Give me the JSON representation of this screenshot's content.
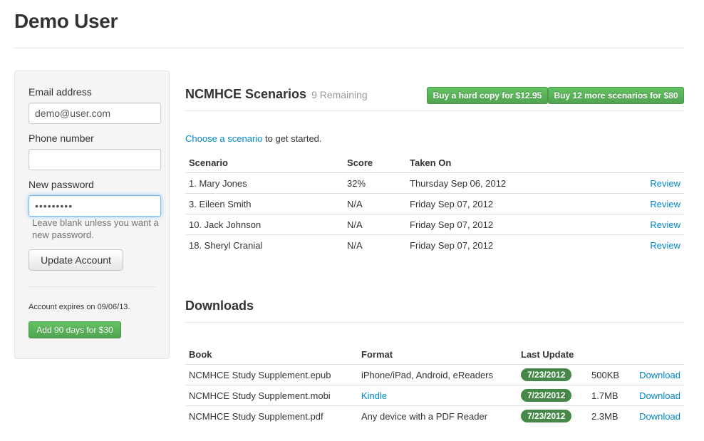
{
  "page": {
    "title": "Demo User"
  },
  "sidebar": {
    "email_label": "Email address",
    "email_value": "demo@user.com",
    "phone_label": "Phone number",
    "phone_value": "",
    "password_label": "New password",
    "password_value": "•••••••••",
    "password_help": "Leave blank unless you want a new password.",
    "update_button": "Update Account",
    "expires_text": "Account expires on 09/06/13.",
    "add_days_button": "Add 90 days for $30"
  },
  "scenarios": {
    "title": "NCMHCE Scenarios",
    "remaining": "9 Remaining",
    "hard_copy_button": "Buy a hard copy for $12.95",
    "more_scenarios_button": "Buy 12 more scenarios for $80",
    "intro_link": "Choose a scenario",
    "intro_rest": " to get started.",
    "columns": [
      "Scenario",
      "Score",
      "Taken On",
      ""
    ],
    "rows": [
      {
        "scenario": "1. Mary Jones",
        "score": "32%",
        "taken_on": "Thursday Sep 06, 2012",
        "action": "Review"
      },
      {
        "scenario": "3. Eileen Smith",
        "score": "N/A",
        "taken_on": "Friday Sep 07, 2012",
        "action": "Review"
      },
      {
        "scenario": "10. Jack Johnson",
        "score": "N/A",
        "taken_on": "Friday Sep 07, 2012",
        "action": "Review"
      },
      {
        "scenario": "18. Sheryl Cranial",
        "score": "N/A",
        "taken_on": "Friday Sep 07, 2012",
        "action": "Review"
      }
    ]
  },
  "downloads": {
    "title": "Downloads",
    "columns": [
      "Book",
      "Format",
      "Last Update",
      "",
      ""
    ],
    "rows": [
      {
        "book": "NCMHCE Study Supplement.epub",
        "format": "iPhone/iPad, Android, eReaders",
        "format_is_link": false,
        "last_update": "7/23/2012",
        "size": "500KB",
        "action": "Download"
      },
      {
        "book": "NCMHCE Study Supplement.mobi",
        "format": "Kindle",
        "format_is_link": true,
        "last_update": "7/23/2012",
        "size": "1.7MB",
        "action": "Download"
      },
      {
        "book": "NCMHCE Study Supplement.pdf",
        "format": "Any device with a PDF Reader",
        "format_is_link": false,
        "last_update": "7/23/2012",
        "size": "2.3MB",
        "action": "Download"
      }
    ]
  },
  "colors": {
    "link": "#0088cc",
    "success_button": "#5bb75b",
    "date_badge": "#468847"
  }
}
